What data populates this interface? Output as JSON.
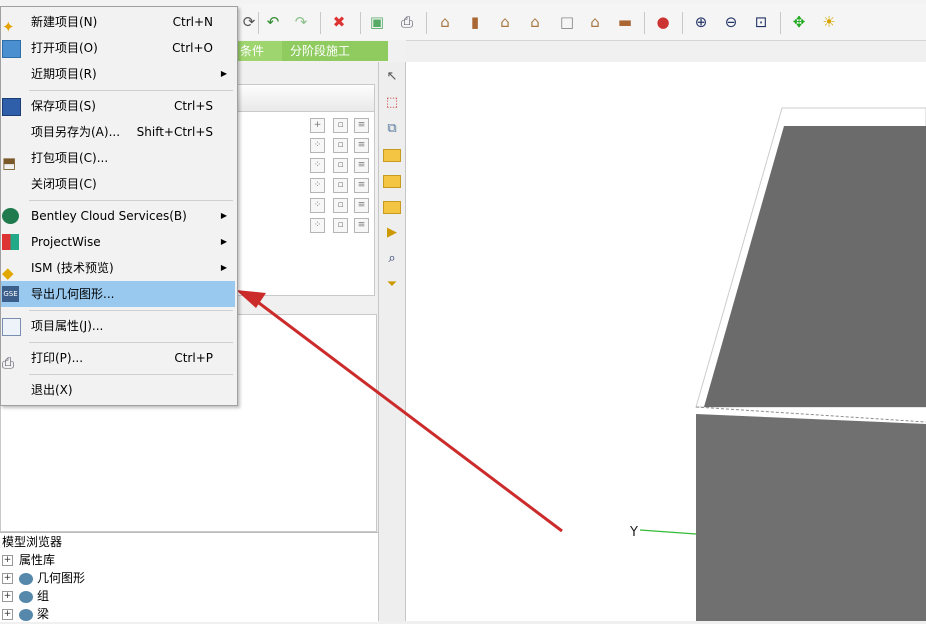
{
  "menu": {
    "items": [
      {
        "label": "新建项目(N)",
        "shortcut": "Ctrl+N"
      },
      {
        "label": "打开项目(O)",
        "shortcut": "Ctrl+O"
      },
      {
        "label": "近期项目(R)",
        "shortcut": ""
      },
      {
        "label": "保存项目(S)",
        "shortcut": "Ctrl+S"
      },
      {
        "label": "项目另存为(A)...",
        "shortcut": "Shift+Ctrl+S"
      },
      {
        "label": "打包项目(C)...",
        "shortcut": ""
      },
      {
        "label": "关闭项目(C)",
        "shortcut": ""
      },
      {
        "label": "Bentley Cloud Services(B)",
        "shortcut": ""
      },
      {
        "label": "ProjectWise",
        "shortcut": ""
      },
      {
        "label": "ISM (技术预览)",
        "shortcut": ""
      },
      {
        "label": "导出几何图形...",
        "shortcut": ""
      },
      {
        "label": "项目属性(J)...",
        "shortcut": ""
      },
      {
        "label": "打印(P)...",
        "shortcut": "Ctrl+P"
      },
      {
        "label": "退出(X)",
        "shortcut": ""
      }
    ],
    "icon_glyphs": {
      "gse": "GSE"
    }
  },
  "stages": [
    "条件",
    "分阶段施工"
  ],
  "model_browser": {
    "title": "模型浏览器",
    "items": [
      "属性库",
      "几何图形",
      "组",
      "梁"
    ]
  },
  "viewport": {
    "axis_label": "Y"
  },
  "colors": {
    "accent_highlight": "#99c9ef",
    "stage_green": "#9ed56e",
    "arrow_red": "#cc2b2b",
    "solid_gray": "#6b6b6b"
  }
}
